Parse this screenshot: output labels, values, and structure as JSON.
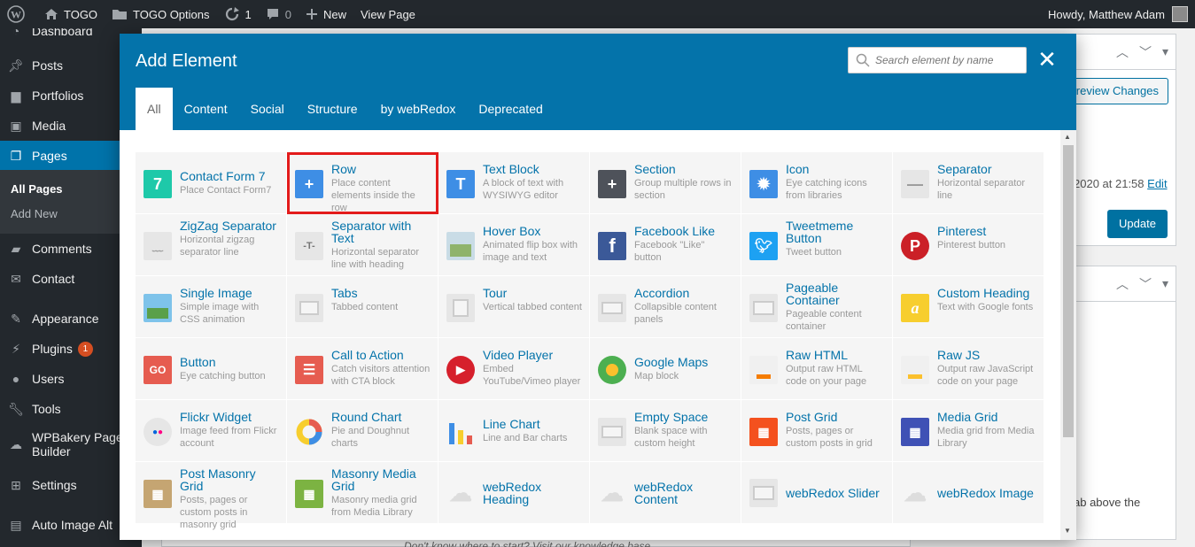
{
  "adminbar": {
    "site": "TOGO",
    "options": "TOGO Options",
    "updates": "1",
    "comments": "0",
    "new": "New",
    "view_page": "View Page",
    "howdy": "Howdy, Matthew Adam"
  },
  "sidebar": {
    "items": [
      "Dashboard",
      "Posts",
      "Portfolios",
      "Media",
      "Pages",
      "Comments",
      "Contact",
      "Appearance",
      "Plugins",
      "Users",
      "Tools",
      "WPBakery Page Builder",
      "Settings",
      "Auto Image Alt"
    ],
    "plugins_badge": "1",
    "sub": [
      "All Pages",
      "Add New"
    ]
  },
  "background": {
    "preview": "Preview Changes",
    "date": "2020 at 21:58",
    "edit": "Edit",
    "update": "Update",
    "tab_above": "ab above the",
    "knowledge": "Don't know where to start? Visit our knowledge base."
  },
  "modal": {
    "title": "Add Element",
    "search_placeholder": "Search element by name",
    "tabs": [
      "All",
      "Content",
      "Social",
      "Structure",
      "by webRedox",
      "Deprecated"
    ],
    "elements": [
      {
        "name": "Contact Form 7",
        "desc": "Place Contact Form7"
      },
      {
        "name": "Row",
        "desc": "Place content elements inside the row"
      },
      {
        "name": "Text Block",
        "desc": "A block of text with WYSIWYG editor"
      },
      {
        "name": "Section",
        "desc": "Group multiple rows in section"
      },
      {
        "name": "Icon",
        "desc": "Eye catching icons from libraries"
      },
      {
        "name": "Separator",
        "desc": "Horizontal separator line"
      },
      {
        "name": "ZigZag Separator",
        "desc": "Horizontal zigzag separator line"
      },
      {
        "name": "Separator with Text",
        "desc": "Horizontal separator line with heading"
      },
      {
        "name": "Hover Box",
        "desc": "Animated flip box with image and text"
      },
      {
        "name": "Facebook Like",
        "desc": "Facebook \"Like\" button"
      },
      {
        "name": "Tweetmeme Button",
        "desc": "Tweet button"
      },
      {
        "name": "Pinterest",
        "desc": "Pinterest button"
      },
      {
        "name": "Single Image",
        "desc": "Simple image with CSS animation"
      },
      {
        "name": "Tabs",
        "desc": "Tabbed content"
      },
      {
        "name": "Tour",
        "desc": "Vertical tabbed content"
      },
      {
        "name": "Accordion",
        "desc": "Collapsible content panels"
      },
      {
        "name": "Pageable Container",
        "desc": "Pageable content container"
      },
      {
        "name": "Custom Heading",
        "desc": "Text with Google fonts"
      },
      {
        "name": "Button",
        "desc": "Eye catching button"
      },
      {
        "name": "Call to Action",
        "desc": "Catch visitors attention with CTA block"
      },
      {
        "name": "Video Player",
        "desc": "Embed YouTube/Vimeo player"
      },
      {
        "name": "Google Maps",
        "desc": "Map block"
      },
      {
        "name": "Raw HTML",
        "desc": "Output raw HTML code on your page"
      },
      {
        "name": "Raw JS",
        "desc": "Output raw JavaScript code on your page"
      },
      {
        "name": "Flickr Widget",
        "desc": "Image feed from Flickr account"
      },
      {
        "name": "Round Chart",
        "desc": "Pie and Doughnut charts"
      },
      {
        "name": "Line Chart",
        "desc": "Line and Bar charts"
      },
      {
        "name": "Empty Space",
        "desc": "Blank space with custom height"
      },
      {
        "name": "Post Grid",
        "desc": "Posts, pages or custom posts in grid"
      },
      {
        "name": "Media Grid",
        "desc": "Media grid from Media Library"
      },
      {
        "name": "Post Masonry Grid",
        "desc": "Posts, pages or custom posts in masonry grid"
      },
      {
        "name": "Masonry Media Grid",
        "desc": "Masonry media grid from Media Library"
      },
      {
        "name": "webRedox Heading",
        "desc": ""
      },
      {
        "name": "webRedox Content",
        "desc": ""
      },
      {
        "name": "webRedox Slider",
        "desc": ""
      },
      {
        "name": "webRedox Image",
        "desc": ""
      }
    ]
  },
  "colors": {
    "modal_header": "#0473aa",
    "admin_dark": "#23282d",
    "highlight": "#e31b1b",
    "link_blue": "#0473aa"
  }
}
